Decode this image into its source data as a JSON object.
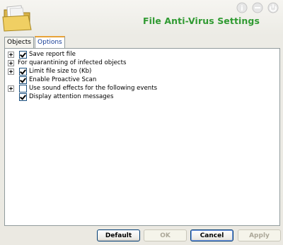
{
  "header": {
    "title": "File Anti-Virus Settings",
    "icons": [
      "folder-icon",
      "help-icon",
      "minimize-icon",
      "power-icon"
    ],
    "title_color": "#2f9a31"
  },
  "tabs": [
    {
      "label": "Objects",
      "active": false
    },
    {
      "label": "Options",
      "active": true
    }
  ],
  "tree": {
    "items": [
      {
        "label": "Save report file",
        "expandable": true,
        "has_checkbox": true,
        "checked": true
      },
      {
        "label": "For quarantining of infected objects",
        "expandable": true,
        "has_checkbox": false,
        "checked": false
      },
      {
        "label": "Limit file size to (Kb)",
        "expandable": true,
        "has_checkbox": true,
        "checked": true
      },
      {
        "label": "Enable Proactive Scan",
        "expandable": false,
        "has_checkbox": true,
        "checked": true
      },
      {
        "label": "Use sound effects for the following events",
        "expandable": true,
        "has_checkbox": true,
        "checked": false
      },
      {
        "label": "Display attention messages",
        "expandable": false,
        "has_checkbox": true,
        "checked": true
      }
    ]
  },
  "buttons": {
    "default": {
      "label": "Default",
      "enabled": true
    },
    "ok": {
      "label": "OK",
      "enabled": false
    },
    "cancel": {
      "label": "Cancel",
      "enabled": true
    },
    "apply": {
      "label": "Apply",
      "enabled": false
    }
  }
}
